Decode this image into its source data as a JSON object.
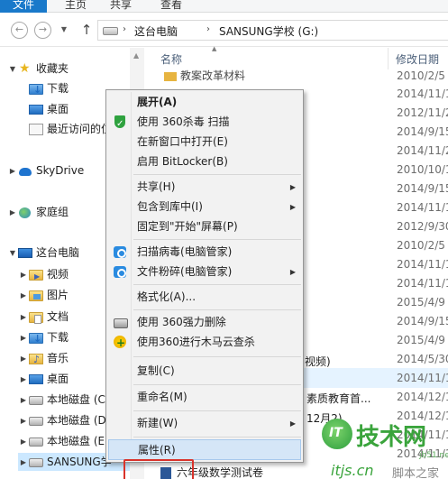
{
  "ribbon": {
    "tabs": [
      "文件",
      "主页",
      "共享",
      "查看"
    ]
  },
  "address": {
    "crumbs": [
      "这台电脑",
      "SANSUNG学校 (G:)"
    ]
  },
  "navpane": {
    "favorites": "收藏夹",
    "downloads": "下载",
    "desktop": "桌面",
    "recent": "最近访问的位",
    "skydrive": "SkyDrive",
    "homegroup": "家庭组",
    "thispc": "这台电脑",
    "videos": "视频",
    "pictures": "图片",
    "documents": "文档",
    "downloads2": "下载",
    "music": "音乐",
    "desktop2": "桌面",
    "diskC": "本地磁盘 (C",
    "diskD": "本地磁盘 (D",
    "diskE": "本地磁盘 (E:",
    "usb": "SANSUNG学"
  },
  "filelist": {
    "col_name": "名称",
    "col_date": "修改日期",
    "top_partial": "教案改革材料",
    "dates": [
      "2010/2/5",
      "2014/11/1",
      "2012/11/2",
      "2014/9/15",
      "2014/11/2",
      "2010/10/1",
      "2014/9/15",
      "2014/11/1",
      "2012/9/30",
      "2010/2/5",
      "2014/11/1",
      "2014/11/1",
      "2015/4/9",
      "2014/9/15",
      "2015/4/9",
      "2014/5/30",
      "2014/11/1",
      "2014/12/1",
      "2014/12/1",
      "2014/11/1",
      "2014/11/1"
    ],
    "partial_shipin": "视频)",
    "partial_suzhi": "素质教育首...",
    "partial_2yue": "12月2)",
    "last_row": "六年级数学测试卷"
  },
  "menu": {
    "expand": "展开(A)",
    "scan360": "使用 360杀毒 扫描",
    "newwindow": "在新窗口中打开(E)",
    "bitlocker": "启用 BitLocker(B)",
    "share": "共享(H)",
    "library": "包含到库中(I)",
    "pinstart": "固定到\"开始\"屏幕(P)",
    "scanvirus": "扫描病毒(电脑管家)",
    "shredder": "文件粉碎(电脑管家)",
    "format": "格式化(A)...",
    "del360": "使用 360强力删除",
    "trojan360": "使用360进行木马云查杀",
    "copy": "复制(C)",
    "rename": "重命名(M)",
    "new": "新建(W)",
    "properties": "属性(R)"
  },
  "watermark": {
    "big": "技术网",
    "small": "jb51.net",
    "url": "itjs.cn",
    "jb": "脚本之家"
  }
}
